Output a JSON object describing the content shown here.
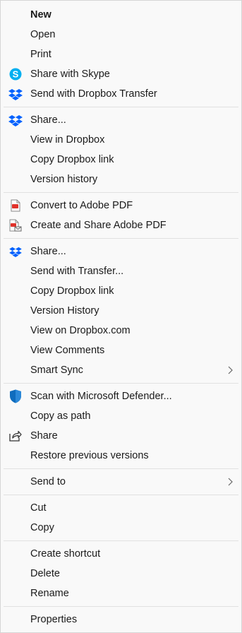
{
  "menu": {
    "g1": {
      "new": "New",
      "open": "Open",
      "print": "Print",
      "share_skype": "Share with Skype",
      "send_dropbox_transfer": "Send with Dropbox Transfer"
    },
    "g2": {
      "share": "Share...",
      "view_dropbox": "View in Dropbox",
      "copy_link": "Copy Dropbox link",
      "version_history": "Version history"
    },
    "g3": {
      "convert_pdf": "Convert to Adobe PDF",
      "create_share_pdf": "Create and Share Adobe PDF"
    },
    "g4": {
      "share": "Share...",
      "send_transfer": "Send with Transfer...",
      "copy_link": "Copy Dropbox link",
      "version_history": "Version History",
      "view_dropbox_com": "View on Dropbox.com",
      "view_comments": "View Comments",
      "smart_sync": "Smart Sync"
    },
    "g5": {
      "scan_defender": "Scan with Microsoft Defender...",
      "copy_path": "Copy as path",
      "share": "Share",
      "restore": "Restore previous versions"
    },
    "g6": {
      "send_to": "Send to"
    },
    "g7": {
      "cut": "Cut",
      "copy": "Copy"
    },
    "g8": {
      "create_shortcut": "Create shortcut",
      "delete": "Delete",
      "rename": "Rename"
    },
    "g9": {
      "properties": "Properties"
    },
    "icons": {
      "skype": "skype-icon",
      "dropbox": "dropbox-icon",
      "adobe_pdf": "adobe-pdf-icon",
      "adobe_pdf_share": "adobe-pdf-share-icon",
      "defender": "defender-shield-icon",
      "share": "share-icon",
      "chevron": "chevron-right-icon"
    },
    "colors": {
      "background": "#f9f9f9",
      "separator": "#e1e1e1",
      "dropbox": "#0061fe",
      "skype": "#00aff0",
      "adobe": "#e0322b",
      "defender": "#0f6cbd"
    }
  }
}
